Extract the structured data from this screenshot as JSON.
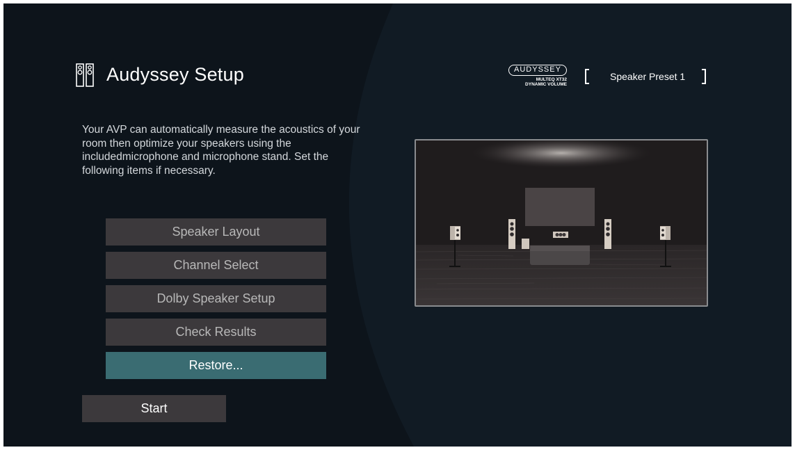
{
  "header": {
    "title": "Audyssey Setup",
    "icon": "speakers-icon"
  },
  "brand": {
    "name": "AUDYSSEY",
    "line1": "MULTEQ XT32",
    "line2": "DYNAMIC VOLUME"
  },
  "preset": {
    "label": "Speaker Preset 1"
  },
  "description": "Your AVP can automatically measure the acoustics of your room then optimize your speakers using the includedmicrophone and microphone stand. Set the following items if necessary.",
  "menu": {
    "items": [
      {
        "label": "Speaker Layout"
      },
      {
        "label": "Channel Select"
      },
      {
        "label": "Dolby Speaker Setup"
      },
      {
        "label": "Check Results"
      },
      {
        "label": "Restore..."
      }
    ],
    "selected_index": 4
  },
  "start_label": "Start",
  "colors": {
    "background": "#0d141b",
    "button": "#3c393c",
    "selected": "#3a6c72",
    "text": "#ffffff"
  }
}
